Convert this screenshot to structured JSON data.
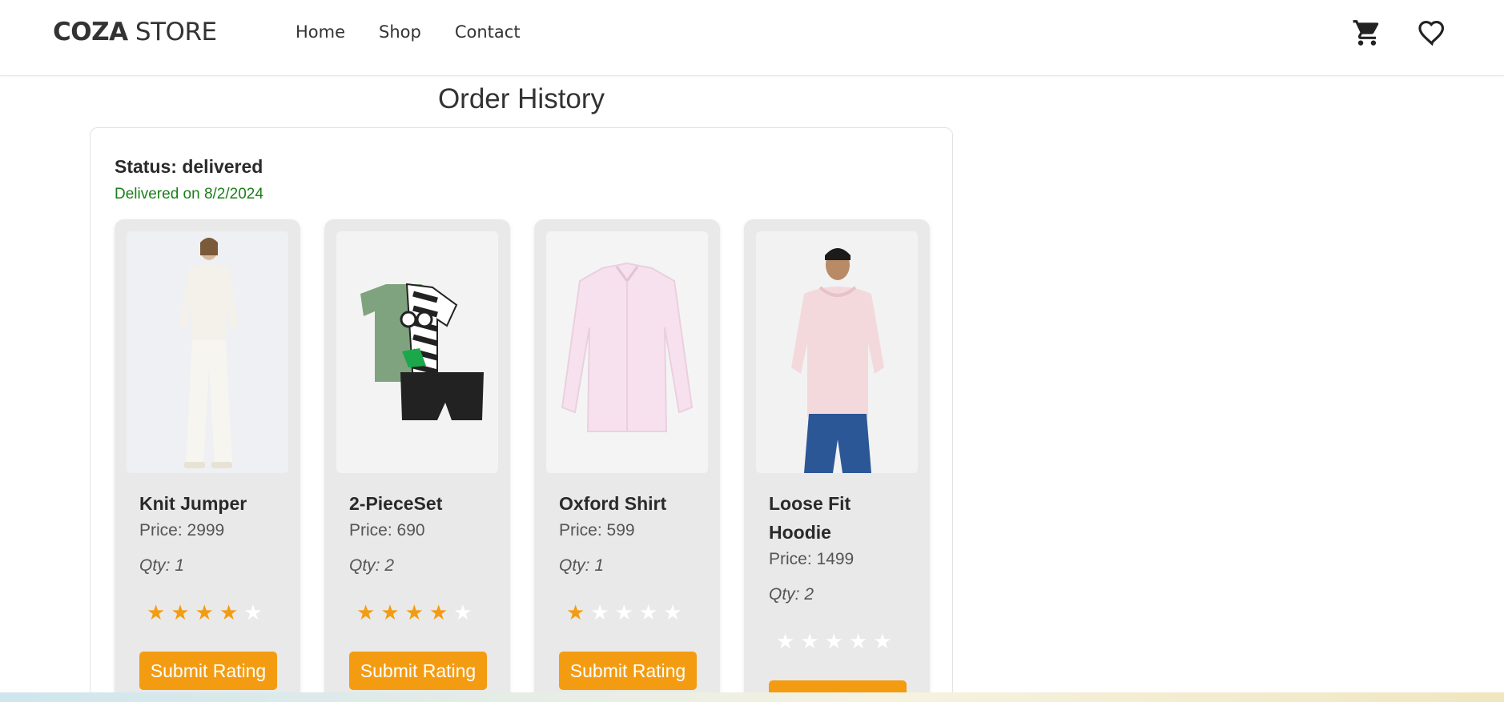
{
  "header": {
    "logo_bold": "COZA",
    "logo_rest": " STORE",
    "nav": [
      "Home",
      "Shop",
      "Contact"
    ],
    "icons": [
      "cart-icon",
      "heart-icon"
    ]
  },
  "page_title": "Order History",
  "order": {
    "status": "Status: delivered",
    "delivered": "Delivered on 8/2/2024",
    "products": [
      {
        "name": "Knit Jumper",
        "price": "Price: 2999",
        "qty": "Qty: 1",
        "rating": 4,
        "button": "Submit Rating"
      },
      {
        "name": "2-PieceSet",
        "price": "Price: 690",
        "qty": "Qty: 2",
        "rating": 4,
        "button": "Submit Rating"
      },
      {
        "name": "Oxford Shirt",
        "price": "Price: 599",
        "qty": "Qty: 1",
        "rating": 1,
        "button": "Submit Rating"
      },
      {
        "name": "Loose Fit Hoodie",
        "price": "Price: 1499",
        "qty": "Qty: 2",
        "rating": 0,
        "button": "Submit Rating"
      }
    ]
  },
  "colors": {
    "accent": "#f39c12",
    "delivered": "#1a7f1a",
    "card_bg": "#e9e9e9"
  }
}
